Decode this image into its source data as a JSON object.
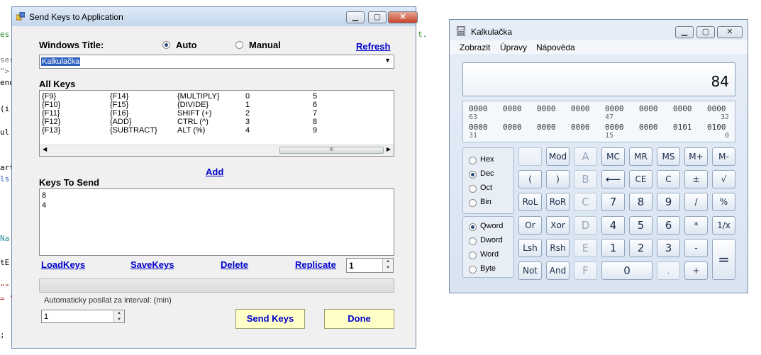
{
  "background": {
    "code_fragments": [
      "es",
      "ser",
      "\">",
      "end",
      "(i",
      "ul",
      "art",
      "ls",
      "Na",
      "tE",
      "\"\"",
      "= \"",
      "t.",
      ";"
    ]
  },
  "send_keys": {
    "title": "Send Keys to Application",
    "windows_title_label": "Windows Title:",
    "mode_auto": "Auto",
    "mode_manual": "Manual",
    "mode_selected": "Auto",
    "refresh": "Refresh",
    "window_value": "Kalkulačka",
    "all_keys_label": "All Keys",
    "all_keys_columns": [
      [
        "{F9}",
        "{F10}",
        "{F11}",
        "{F12}",
        "{F13}"
      ],
      [
        "{F14}",
        "{F15}",
        "{F16}",
        "{ADD}",
        "{SUBTRACT}"
      ],
      [
        "{MULTIPLY}",
        "{DIVIDE}",
        "SHIFT (+)",
        "CTRL (^)",
        "ALT (%)"
      ],
      [
        "0",
        "1",
        "2",
        "3",
        "4"
      ],
      [
        "5",
        "6",
        "7",
        "8",
        "9"
      ]
    ],
    "add": "Add",
    "keys_to_send_label": "Keys To Send",
    "keys_to_send": [
      "8",
      "4"
    ],
    "load_keys": "LoadKeys",
    "save_keys": "SaveKeys",
    "delete": "Delete",
    "replicate": "Replicate",
    "replicate_value": "1",
    "interval_label": "Automaticky posílat za interval: (min)",
    "interval_value": "1",
    "send_keys_button": "Send Keys",
    "done_button": "Done",
    "scrollbar_thumb_glyph": "III"
  },
  "calculator": {
    "title": "Kalkulačka",
    "menu": [
      "Zobrazit",
      "Úpravy",
      "Nápověda"
    ],
    "display": "84",
    "bits_row1": [
      "0000",
      "0000",
      "0000",
      "0000",
      "0000",
      "0000",
      "0000",
      "0000"
    ],
    "bits_row1_index": [
      "63",
      "47",
      "32"
    ],
    "bits_row2": [
      "0000",
      "0000",
      "0000",
      "0000",
      "0000",
      "0000",
      "0101",
      "0100"
    ],
    "bits_row2_index": [
      "31",
      "15",
      "0"
    ],
    "radix": [
      "Hex",
      "Dec",
      "Oct",
      "Bin"
    ],
    "radix_selected": "Dec",
    "word_size": [
      "Qword",
      "Dword",
      "Word",
      "Byte"
    ],
    "word_selected": "Qword",
    "buttons": {
      "mod": "Mod",
      "a": "A",
      "mc": "MC",
      "mr": "MR",
      "ms": "MS",
      "mplus": "M+",
      "mminus": "M-",
      "lparen": "(",
      "rparen": ")",
      "b": "B",
      "back": "⟵",
      "ce": "CE",
      "c": "C",
      "plusminus": "±",
      "sqrt": "√",
      "rol": "RoL",
      "ror": "RoR",
      "c_hex": "C",
      "n7": "7",
      "n8": "8",
      "n9": "9",
      "div": "/",
      "pct": "%",
      "or": "Or",
      "xor": "Xor",
      "d": "D",
      "n4": "4",
      "n5": "5",
      "n6": "6",
      "mul": "*",
      "recip": "1/x",
      "lsh": "Lsh",
      "rsh": "Rsh",
      "e": "E",
      "n1": "1",
      "n2": "2",
      "n3": "3",
      "minus": "-",
      "eq": "=",
      "not": "Not",
      "and": "And",
      "f": "F",
      "n0": "0",
      "comma": ",",
      "plus": "+"
    }
  }
}
